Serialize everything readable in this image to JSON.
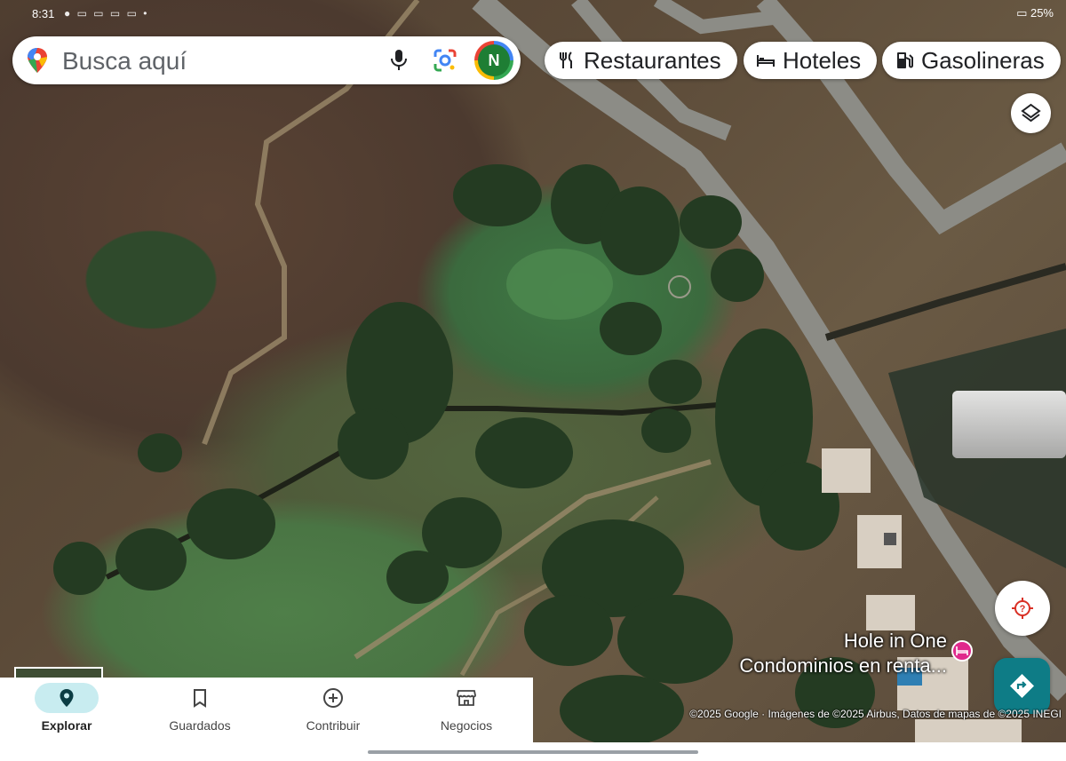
{
  "status_bar": {
    "time": "8:31",
    "battery": "25%"
  },
  "search": {
    "placeholder": "Busca aquí",
    "avatar_initial": "N",
    "icons": [
      "maps-pin-icon",
      "mic-icon",
      "lens-icon"
    ]
  },
  "chips": [
    {
      "label": "Restaurantes",
      "icon": "fork-knife-icon"
    },
    {
      "label": "Hoteles",
      "icon": "bed-icon"
    },
    {
      "label": "Gasolineras",
      "icon": "gas-pump-icon"
    }
  ],
  "map": {
    "place_name_line1": "Hole in One",
    "place_name_line2": "Condominios en renta...",
    "attribution": "©2025 Google · Imágenes de ©2025 Airbus, Datos de mapas de ©2025 INEGI"
  },
  "bottom_nav": [
    {
      "label": "Explorar",
      "icon": "location-pin-icon",
      "active": true
    },
    {
      "label": "Guardados",
      "icon": "bookmark-icon",
      "active": false
    },
    {
      "label": "Contribuir",
      "icon": "add-circle-icon",
      "active": false
    },
    {
      "label": "Negocios",
      "icon": "storefront-icon",
      "active": false
    }
  ],
  "colors": {
    "accent": "#0e7c86",
    "active_pill": "#c8ecf0",
    "marker": "#e0298c"
  }
}
